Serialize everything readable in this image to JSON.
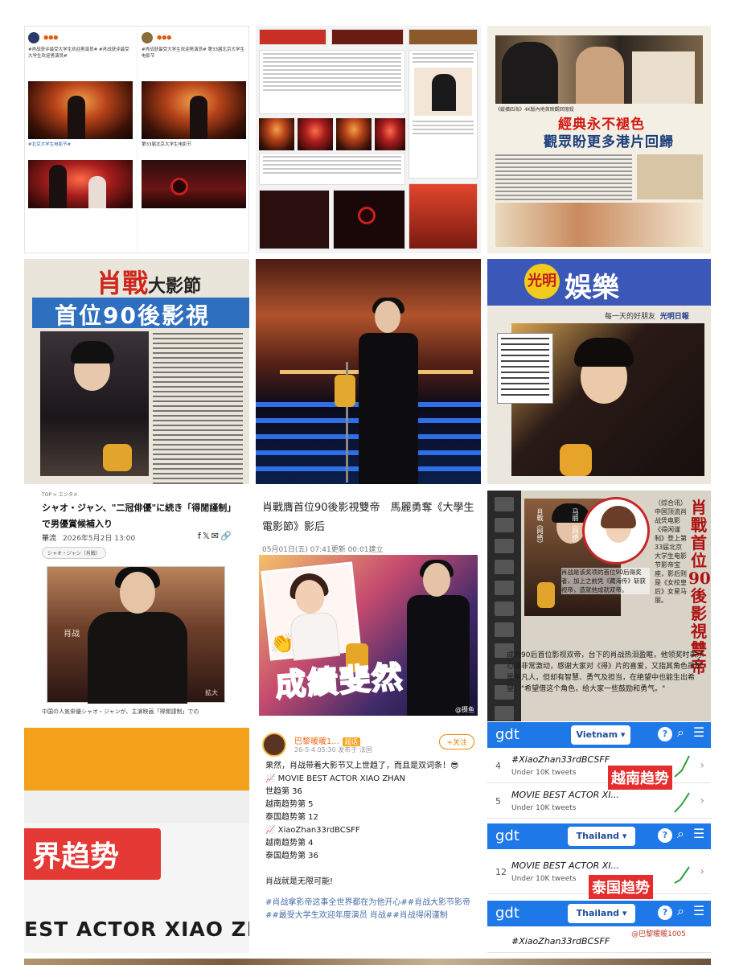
{
  "tile_weibo": {
    "post1": {
      "text": "#肖战获评最受大学生欢迎男演员# #肖战获评最受大学生欢迎男演员#",
      "tag": "#北京大学生电影节#"
    },
    "post2": {
      "text": "#肖战获最受大学生欢迎男演员# 第33届北京大学生电影节"
    },
    "post3": {
      "text": "#肖战获最受大学生欢迎男演员#"
    },
    "post4": {
      "text": "第33届北京大学生电影节"
    }
  },
  "tile_paper_hk": {
    "headline_red": "經典永不褪色",
    "headline_blue": "觀眾盼更多港片回歸",
    "caption": "《縱橫四海》4K版內地首映觀回憶殺",
    "sub": "縱橫四海"
  },
  "tile_newspaper1": {
    "title_red": "肖戰",
    "title_black": "大影節",
    "banner": "首位90後影視"
  },
  "tile_newspaper2": {
    "circle": "光明",
    "title": "娛樂",
    "sub_prefix": "每一天的好朋友",
    "sub_brand": "光明日報"
  },
  "tile_jp": {
    "top": "TOP > エンタメ",
    "title": "シャオ・ジャン、\"二冠俳優\"に続き「得閒謹制」で男優賞候補入り",
    "source": "華流",
    "date": "2026年5月2日 13:00",
    "tag": "シャオ・ジャン（肖戦）",
    "photo_name": "肖战",
    "enlarge": "拡大",
    "bottom": "中国の人気俳優シャオ・ジャンが、主演映画「得閒謹制」での"
  },
  "tile_hk": {
    "title": "肖戰膺首位90後影視雙帝　馬麗勇奪《大學生電影節》影后",
    "date": "05月01日(五) 07:41更新 00:01建立",
    "big": "成績斐然",
    "watermark": "@摄鱼"
  },
  "tile_tw": {
    "vertical_head": "肖戰首位90後影視雙帝",
    "label1": "肖戰（网络）",
    "label2": "马丽（网络）",
    "body": "（综合讯）中国顶流肖战凭电影《得闲谨制》登上第33届北京大学生电影节影帝宝座，影后则是《女校皇后》女星马丽。",
    "quote": "肖战是该奖项的首位90后得奖者，加上之前凭《藏海传》斩获视帝，造就他成就双帝。",
    "para": "成为90后首位影视双帝，台下的肖战热泪盈眶，他领奖时表示心情非常激动，感谢大家对《得》片的喜爱，又指其角色虽然是平凡人，但却有智慧、勇气及担当，在绝望中也能生出希望：\"希望借这个角色，给大家一些鼓励和勇气。\""
  },
  "tile_trend_zoom": {
    "label": "界趋势",
    "actor": "EST ACTOR XIAO ZHA"
  },
  "tile_weibo_post": {
    "name": "巴黎暖暖1...",
    "badge": "超话",
    "meta": "26-5-4 05:30 发布于 法国",
    "follow": "+关注",
    "lines": [
      "果然，肖战带着大影节又上世趋了，而且是双词条！😎",
      "📈 MOVIE BEST ACTOR XIAO ZHAN",
      "世趋第 36",
      "越南趋势第 5",
      "泰国趋势第 12",
      "📈 XiaoZhan33rdBCSFF",
      "越南趋势第 4",
      "泰国趋势第 36",
      "",
      "肖战就是无限可能!"
    ],
    "hashtags": "#肖战拿影帝这事全世界都在为他开心##肖战大影节影帝##最受大学生欢迎年度演员 肖战##肖战得闲谨制"
  },
  "tile_gdt": {
    "logo": "gdt",
    "country1": "Vietnam ▾",
    "country2": "Thailand ▾",
    "country3": "Thailand ▾",
    "qm": "?",
    "rows_vn": [
      {
        "rank": "4",
        "name": "#XiaoZhan33rdBCSFF",
        "count": "Under 10K tweets"
      },
      {
        "rank": "5",
        "name": "MOVIE BEST ACTOR XI...",
        "count": "Under 10K tweets"
      }
    ],
    "rows_th": [
      {
        "rank": "12",
        "name": "MOVIE BEST ACTOR XI...",
        "count": "Under 10K tweets"
      }
    ],
    "rows_th2": [
      {
        "rank": "",
        "name": "#XiaoZhan33rdBCSFF",
        "count": ""
      }
    ],
    "tag_vn": "越南趋势",
    "tag_th": "泰国趋势",
    "credit": "@巴黎暖暖1005"
  }
}
